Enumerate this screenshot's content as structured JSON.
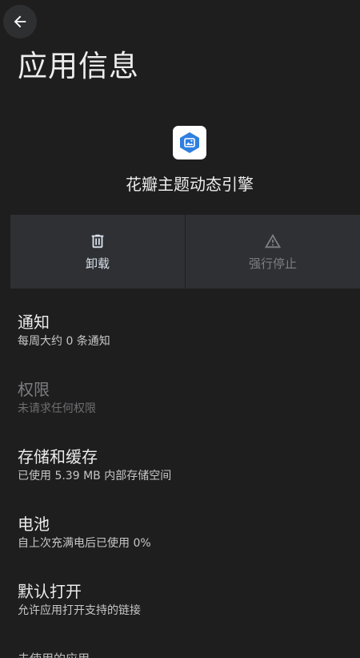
{
  "header": {
    "title": "应用信息",
    "back_icon": "arrow-back-icon"
  },
  "app": {
    "name": "花瓣主题动态引擎",
    "icon": "app-icon",
    "icon_color": "#2f7fe0"
  },
  "actions": [
    {
      "label": "卸载",
      "icon": "trash-icon",
      "enabled": true
    },
    {
      "label": "强行停止",
      "icon": "warning-icon",
      "enabled": false
    }
  ],
  "settings": [
    {
      "title": "通知",
      "summary": "每周大约 0 条通知",
      "enabled": true
    },
    {
      "title": "权限",
      "summary": "未请求任何权限",
      "enabled": false
    },
    {
      "title": "存储和缓存",
      "summary": "已使用 5.39 MB 内部存储空间",
      "enabled": true
    },
    {
      "title": "电池",
      "summary": "自上次充满电后已使用 0%",
      "enabled": true
    },
    {
      "title": "默认打开",
      "summary": "允许应用打开支持的链接",
      "enabled": true
    }
  ],
  "partial_item": "未使用的应用",
  "colors": {
    "background": "#1e1e1f",
    "button_bg": "#2f3033",
    "accent_text": "#d9e2ee"
  }
}
